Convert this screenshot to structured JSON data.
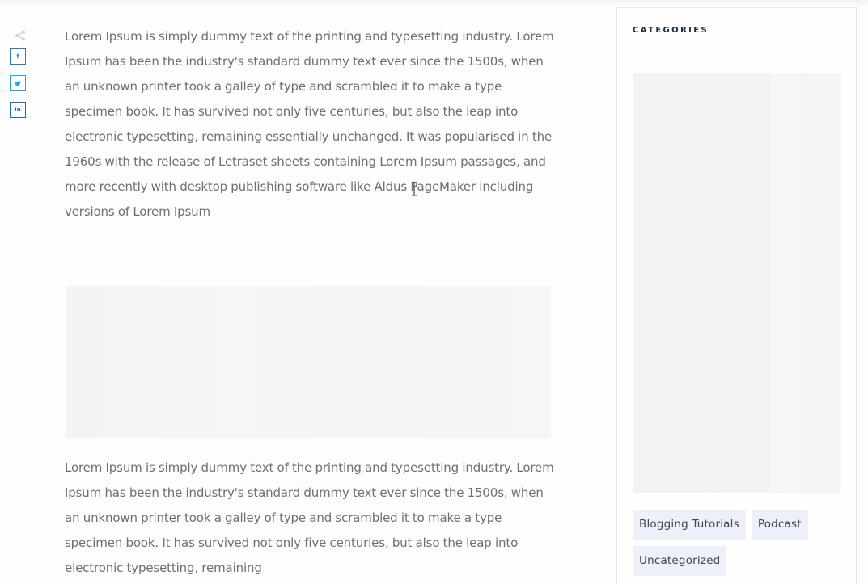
{
  "share": {
    "icon": "share-icon",
    "buttons": [
      {
        "name": "facebook",
        "glyph": "f",
        "color": "#2c7bb8"
      },
      {
        "name": "twitter",
        "glyph": "♥",
        "color": "#2aa0d6"
      },
      {
        "name": "linkedin",
        "glyph": "in",
        "color": "#1f6fa8"
      }
    ]
  },
  "article": {
    "paragraph1": "Lorem Ipsum is simply dummy text of the printing and typesetting industry. Lorem Ipsum has been the industry's standard dummy text ever since the 1500s, when an unknown printer took a galley of type and scrambled it to make a type specimen book. It has survived not only five centuries, but also the leap into electronic typesetting, remaining essentially unchanged. It was popularised in the 1960s with the release of Letraset sheets containing Lorem Ipsum passages, and more recently with desktop publishing software like Aldus PageMaker including versions of Lorem Ipsum",
    "paragraph2": "Lorem Ipsum is simply dummy text of the printing and typesetting industry. Lorem Ipsum has been the industry's standard dummy text ever since the 1500s, when an unknown printer took a galley of type and scrambled it to make a type specimen book. It has survived not only five centuries, but also the leap into electronic typesetting, remaining"
  },
  "sidebar": {
    "title": "CATEGORIES",
    "categories": [
      {
        "label": "Blogging Tutorials"
      },
      {
        "label": "Podcast"
      },
      {
        "label": "Uncategorized"
      }
    ]
  },
  "colors": {
    "text": "#6d6f73",
    "tag_bg": "#edf0f6",
    "facebook": "#2c7bb8",
    "twitter": "#2aa0d6",
    "linkedin": "#1f6fa8"
  }
}
